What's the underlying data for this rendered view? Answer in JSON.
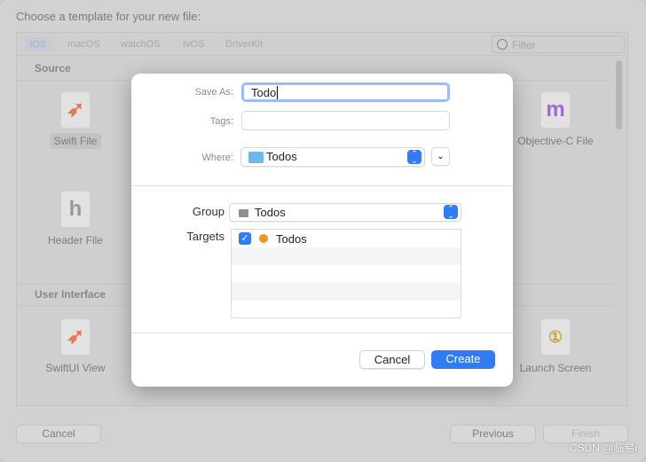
{
  "background": {
    "title": "Choose a template for your new file:",
    "tabs": [
      "iOS",
      "macOS",
      "watchOS",
      "tvOS",
      "DriverKit"
    ],
    "filter_placeholder": "Filter",
    "sections": [
      {
        "title": "Source",
        "items": [
          {
            "label": "Swift File",
            "glyph": "swift",
            "selected": true
          },
          {
            "label": "Header File",
            "glyph": "h"
          },
          {
            "label": "Objective-C File",
            "glyph": "m"
          }
        ]
      },
      {
        "title": "User Interface",
        "items": [
          {
            "label": "SwiftUI View",
            "glyph": "swift"
          },
          {
            "label": "Launch Screen",
            "glyph": "1"
          }
        ]
      }
    ],
    "cancel": "Cancel",
    "previous": "Previous",
    "finish": "Finish"
  },
  "dialog": {
    "save_as_label": "Save As:",
    "save_as_value": "Todo",
    "tags_label": "Tags:",
    "tags_value": "",
    "where_label": "Where:",
    "where_value": "Todos",
    "group_label": "Group",
    "group_value": "Todos",
    "targets_label": "Targets",
    "targets": [
      {
        "name": "Todos",
        "checked": true
      }
    ],
    "cancel": "Cancel",
    "create": "Create"
  },
  "colors": {
    "accent": "#2f7cf6",
    "target_icon": "#f0932b"
  },
  "watermark": "CSDN @临易i"
}
